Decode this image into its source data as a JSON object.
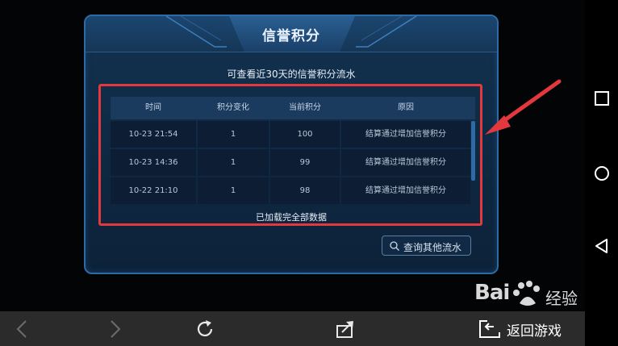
{
  "dialog": {
    "title": "信誉积分",
    "subtitle": "可查看近30天的信誉积分流水",
    "columns": [
      "时间",
      "积分变化",
      "当前积分",
      "原因"
    ],
    "rows": [
      [
        "10-23  21:54",
        "1",
        "100",
        "结算通过增加信誉积分"
      ],
      [
        "10-23  14:36",
        "1",
        "99",
        "结算通过增加信誉积分"
      ],
      [
        "10-22  21:10",
        "1",
        "98",
        "结算通过增加信誉积分"
      ]
    ],
    "loaded_text": "已加载完全部数据",
    "query_button": "查询其他流水"
  },
  "bottom_bar": {
    "back_game": "返回游戏",
    "icons": [
      "back-arrow-icon",
      "forward-arrow-icon",
      "refresh-icon",
      "share-icon",
      "return-icon"
    ]
  },
  "watermark": {
    "brand": "Bai",
    "brand_cn": "经验"
  },
  "colors": {
    "highlight": "#e3383d",
    "dialog_border": "#2f6aa6",
    "bottom_bar": "#2b2b2b"
  }
}
